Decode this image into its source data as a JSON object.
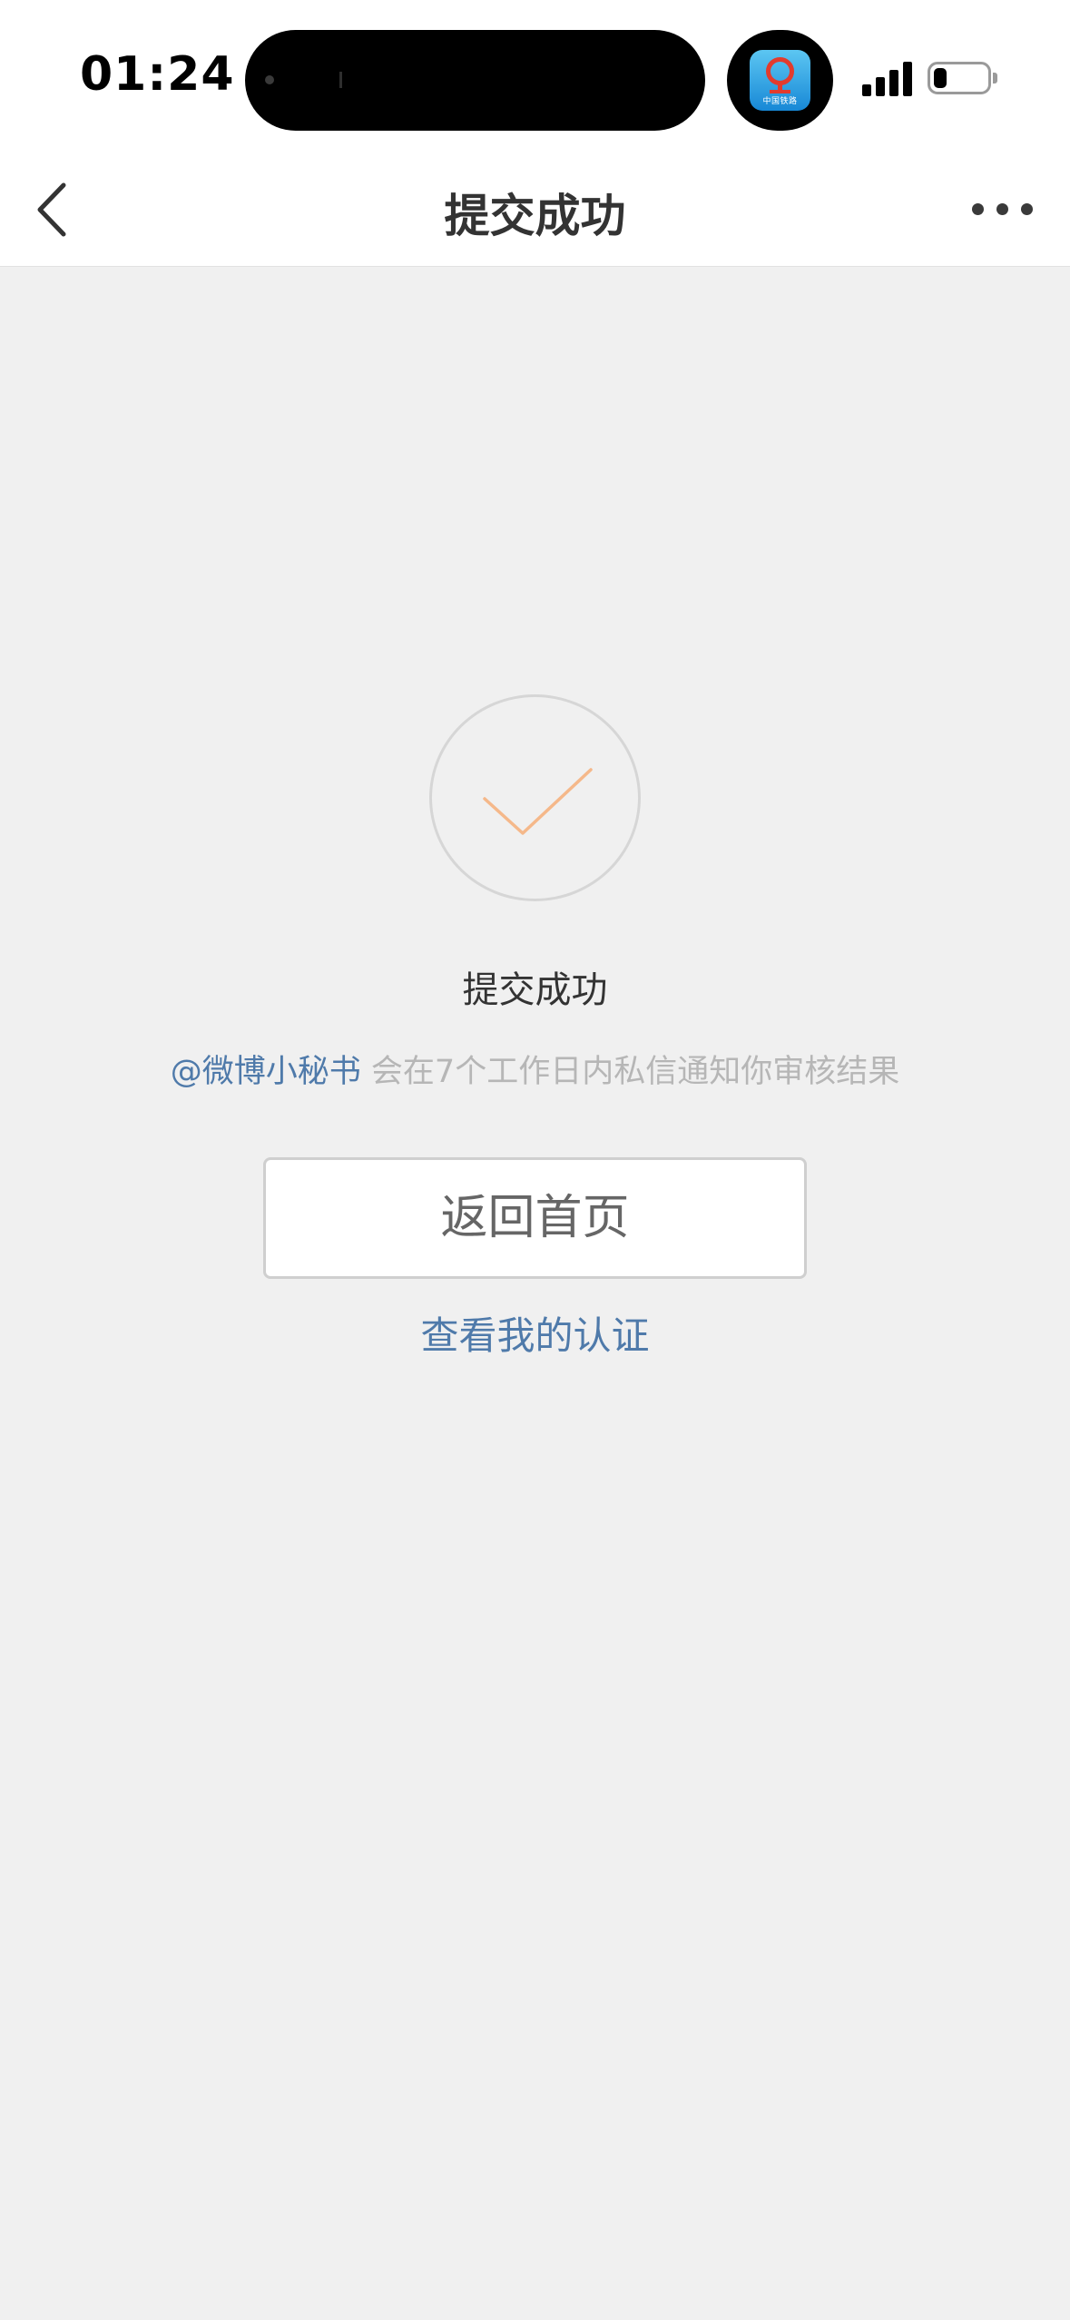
{
  "status_bar": {
    "time": "01:24",
    "app_icon_name": "railway-12306-app-icon",
    "app_icon_text": "中国铁路",
    "signal_icon": "cellular-signal-icon",
    "battery_icon": "battery-low-icon"
  },
  "nav": {
    "title": "提交成功",
    "back_icon": "chevron-left-icon",
    "more_icon": "more-horizontal-icon"
  },
  "main": {
    "success_icon": "checkmark-circle-icon",
    "success_title": "提交成功",
    "notice_mention": "@微博小秘书",
    "notice_text": " 会在7个工作日内私信通知你审核结果",
    "home_button_label": "返回首页",
    "view_certification_label": "查看我的认证"
  },
  "colors": {
    "page_background": "#f0f0f0",
    "link_blue": "#4f7aaa",
    "check_orange": "#f5b88a",
    "muted_text": "#b6b6b6"
  }
}
